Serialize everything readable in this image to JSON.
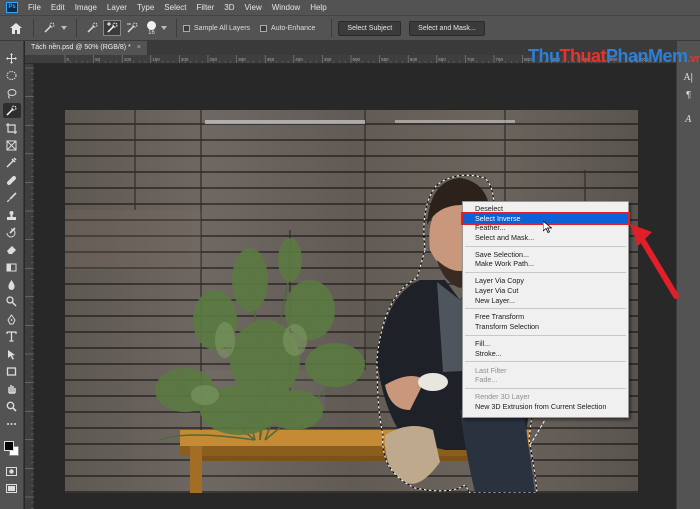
{
  "menubar": {
    "logo": "Ps",
    "items": [
      "File",
      "Edit",
      "Image",
      "Layer",
      "Type",
      "Select",
      "Filter",
      "3D",
      "View",
      "Window",
      "Help"
    ]
  },
  "options": {
    "brush_size": "16",
    "sample_all_layers": "Sample All Layers",
    "auto_enhance": "Auto-Enhance",
    "select_subject": "Select Subject",
    "select_and_mask": "Select and Mask..."
  },
  "document": {
    "tab_title": "Tách nền.psd @ 50% (RGB/8) *",
    "close": "×"
  },
  "ruler": {
    "top_labels": [
      "0",
      "50",
      "100",
      "150",
      "200",
      "250",
      "300",
      "350",
      "400",
      "450",
      "500",
      "550",
      "600",
      "650",
      "700",
      "750",
      "800",
      "850",
      "900",
      "950",
      "1000"
    ]
  },
  "watermark": {
    "part1": "Thu",
    "part2": "Thuat",
    "part3": "PhanMem",
    "suffix": ".vn"
  },
  "right_panel": {
    "icons": [
      "A|",
      "¶",
      "A"
    ]
  },
  "context_menu": {
    "groups": [
      [
        {
          "label": "Deselect"
        },
        {
          "label": "Select Inverse",
          "highlight": true
        },
        {
          "label": "Feather..."
        },
        {
          "label": "Select and Mask..."
        }
      ],
      [
        {
          "label": "Save Selection..."
        },
        {
          "label": "Make Work Path..."
        }
      ],
      [
        {
          "label": "Layer Via Copy"
        },
        {
          "label": "Layer Via Cut"
        },
        {
          "label": "New Layer..."
        }
      ],
      [
        {
          "label": "Free Transform"
        },
        {
          "label": "Transform Selection"
        }
      ],
      [
        {
          "label": "Fill..."
        },
        {
          "label": "Stroke..."
        }
      ],
      [
        {
          "label": "Last Filter",
          "disabled": true
        },
        {
          "label": "Fade...",
          "disabled": true
        }
      ],
      [
        {
          "label": "Render 3D Layer",
          "disabled": true
        },
        {
          "label": "New 3D Extrusion from Current Selection"
        }
      ]
    ]
  },
  "colors": {
    "highlight": "#0a62d6",
    "annotation_red": "#e01f28",
    "ui_gray": "#535353"
  }
}
